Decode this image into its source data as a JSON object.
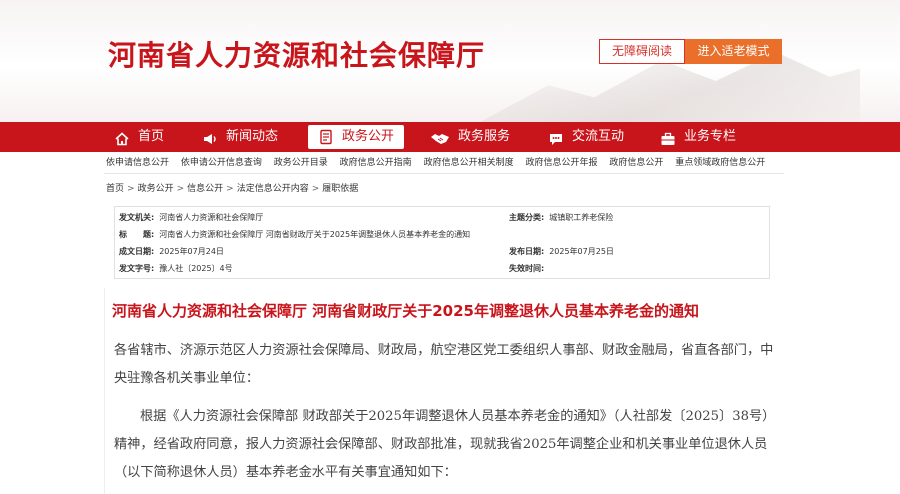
{
  "header": {
    "site_title": "河南省人力资源和社会保障厅",
    "accessible_reading_label": "无障碍阅读",
    "elder_mode_label": "进入适老模式"
  },
  "nav": {
    "items": [
      {
        "label": "首页",
        "icon": "home-icon"
      },
      {
        "label": "新闻动态",
        "icon": "megaphone-icon"
      },
      {
        "label": "政务公开",
        "icon": "document-icon",
        "active": true
      },
      {
        "label": "政务服务",
        "icon": "handshake-icon"
      },
      {
        "label": "交流互动",
        "icon": "chat-icon"
      },
      {
        "label": "业务专栏",
        "icon": "briefcase-icon"
      }
    ]
  },
  "subnav": {
    "items": [
      "依申请信息公开",
      "依申请公开信息查询",
      "政务公开目录",
      "政府信息公开指南",
      "政府信息公开相关制度",
      "政府信息公开年报",
      "政府信息公开",
      "重点领域政府信息公开"
    ]
  },
  "breadcrumb": {
    "items": [
      "首页",
      "政务公开",
      "信息公开",
      "法定信息公开内容",
      "履职依据"
    ],
    "separator": ">"
  },
  "info": {
    "issuer_label": "发文机关:",
    "issuer_value": "河南省人力资源和社会保障厅",
    "topic_label": "主题分类:",
    "topic_value": "城镇职工养老保险",
    "title_label": "标　　题:",
    "title_value": "河南省人力资源和社会保障厅 河南省财政厅关于2025年调整退休人员基本养老金的通知",
    "created_label": "成文日期:",
    "created_value": "2025年07月24日",
    "published_label": "发布日期:",
    "published_value": "2025年07月25日",
    "doc_no_label": "发文字号:",
    "doc_no_value": "豫人社〔2025〕4号",
    "expire_label": "失效时间:",
    "expire_value": ""
  },
  "article": {
    "title": "河南省人力资源和社会保障厅 河南省财政厅关于2025年调整退休人员基本养老金的通知",
    "p1": "各省辖市、济源示范区人力资源社会保障局、财政局，航空港区党工委组织人事部、财政金融局，省直各部门，中央驻豫各机关事业单位：",
    "p2": "根据《人力资源社会保障部 财政部关于2025年调整退休人员基本养老金的通知》（人社部发〔2025〕38号）精神，经省政府同意，报人力资源社会保障部、财政部批准，现就我省2025年调整企业和机关事业单位退休人员（以下简称退休人员）基本养老金水平有关事宜通知如下："
  },
  "colors": {
    "brand_red": "#c8151b",
    "accent_orange": "#e96f2a"
  }
}
